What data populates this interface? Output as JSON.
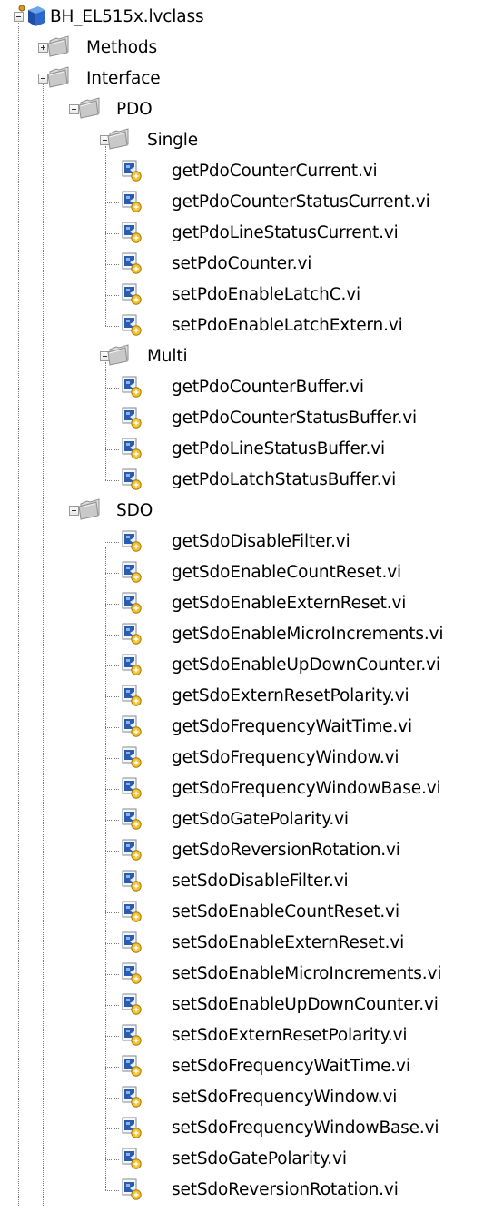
{
  "root": {
    "label": "BH_EL515x.lvclass",
    "icon": "lvclass-icon"
  },
  "methods": {
    "label": "Methods",
    "icon": "folder-icon"
  },
  "interface": {
    "label": "Interface",
    "icon": "folder-icon"
  },
  "pdo": {
    "label": "PDO",
    "icon": "folder-icon"
  },
  "single": {
    "label": "Single",
    "icon": "folder-icon",
    "items": [
      "getPdoCounterCurrent.vi",
      "getPdoCounterStatusCurrent.vi",
      "getPdoLineStatusCurrent.vi",
      "setPdoCounter.vi",
      "setPdoEnableLatchC.vi",
      "setPdoEnableLatchExtern.vi"
    ]
  },
  "multi": {
    "label": "Multi",
    "icon": "folder-icon",
    "items": [
      "getPdoCounterBuffer.vi",
      "getPdoCounterStatusBuffer.vi",
      "getPdoLineStatusBuffer.vi",
      "getPdoLatchStatusBuffer.vi"
    ]
  },
  "sdo": {
    "label": "SDO",
    "icon": "folder-icon",
    "items": [
      "getSdoDisableFilter.vi",
      "getSdoEnableCountReset.vi",
      "getSdoEnableExternReset.vi",
      "getSdoEnableMicroIncrements.vi",
      "getSdoEnableUpDownCounter.vi",
      "getSdoExternResetPolarity.vi",
      "getSdoFrequencyWaitTime.vi",
      "getSdoFrequencyWindow.vi",
      "getSdoFrequencyWindowBase.vi",
      "getSdoGatePolarity.vi",
      "getSdoReversionRotation.vi",
      "setSdoDisableFilter.vi",
      "setSdoEnableCountReset.vi",
      "setSdoEnableExternReset.vi",
      "setSdoEnableMicroIncrements.vi",
      "setSdoEnableUpDownCounter.vi",
      "setSdoExternResetPolarity.vi",
      "setSdoFrequencyWaitTime.vi",
      "setSdoFrequencyWindow.vi",
      "setSdoFrequencyWindowBase.vi",
      "setSdoGatePolarity.vi",
      "setSdoReversionRotation.vi"
    ]
  },
  "colors": {
    "folder_body": "#dcdcdc",
    "folder_edge": "#8f8f8f",
    "vi_blue": "#2a5db0",
    "vi_yellow": "#f2c230",
    "tree_line": "#7a7a7a"
  }
}
